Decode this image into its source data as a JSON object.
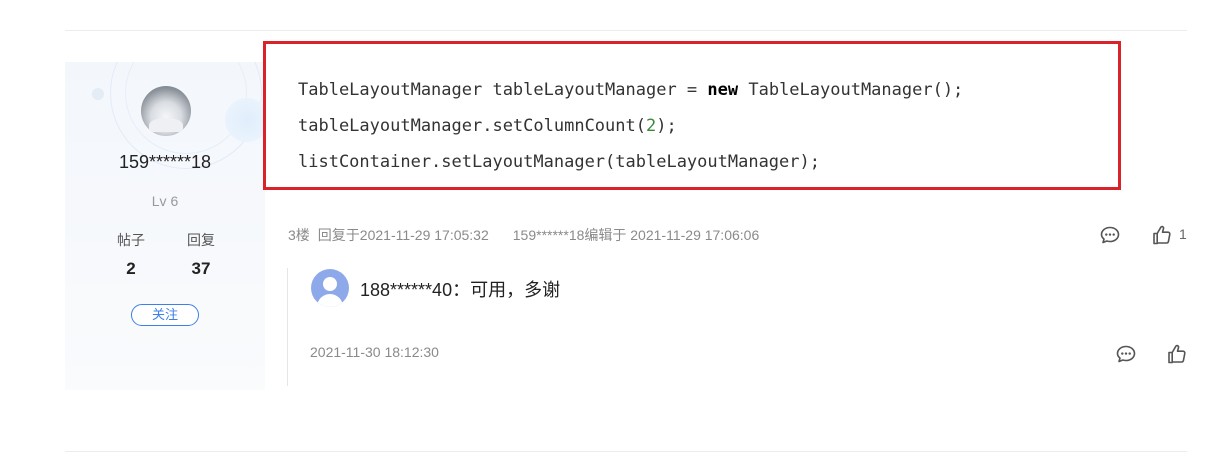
{
  "user": {
    "name": "159******18",
    "level": "Lv 6",
    "posts_label": "帖子",
    "posts_value": "2",
    "replies_label": "回复",
    "replies_value": "37",
    "follow_label": "关注"
  },
  "code": {
    "line1_a": "TableLayoutManager tableLayoutManager = ",
    "line1_kw": "new",
    "line1_b": " TableLayoutManager();",
    "line2_a": "tableLayoutManager.setColumnCount(",
    "line2_num": "2",
    "line2_b": ");",
    "line3": "listContainer.setLayoutManager(tableLayoutManager);"
  },
  "post_meta": {
    "floor": "3楼",
    "reply_time": "回复于2021-11-29 17:05:32",
    "edited": "159******18编辑于 2021-11-29 17:06:06",
    "like_count": "1"
  },
  "comment": {
    "author": "188******40",
    "separator": "：",
    "text": "可用，多谢",
    "time": "2021-11-30 18:12:30"
  },
  "icons": {
    "comment": "comment-icon",
    "like": "thumbs-up-icon"
  },
  "colors": {
    "code_border": "#d9222a",
    "accent": "#3d7fe8",
    "muted_text": "#8a8a8a"
  }
}
